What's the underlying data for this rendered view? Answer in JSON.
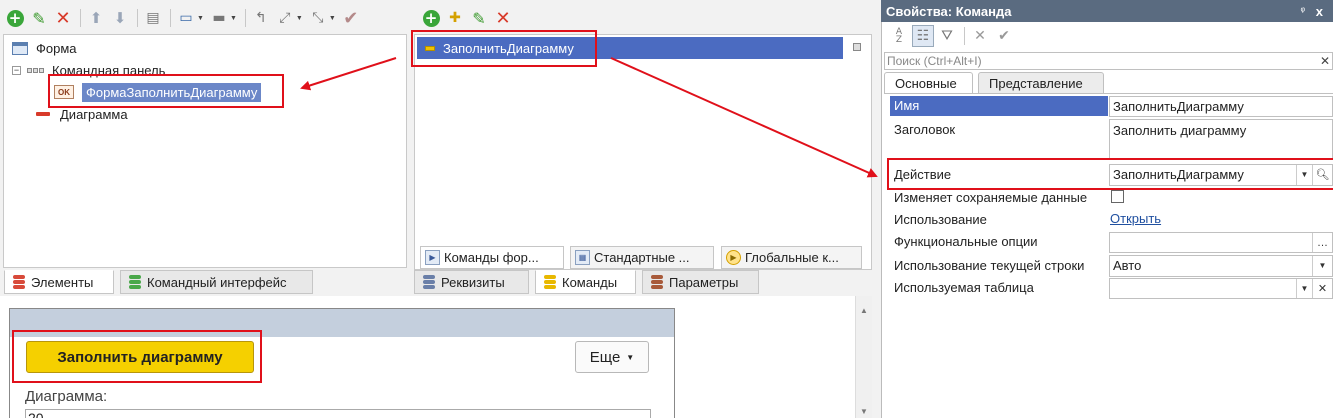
{
  "tree": {
    "items": [
      {
        "label": "Форма"
      },
      {
        "label": "Командная панель"
      },
      {
        "label": "ФормаЗаполнитьДиаграмму"
      },
      {
        "label": "Диаграмма"
      }
    ]
  },
  "left_tabs": [
    "Элементы",
    "Командный интерфейс"
  ],
  "commands": {
    "selected": "ЗаполнитьДиаграмму",
    "inner_tabs": [
      "Команды фор...",
      "Стандартные ...",
      "Глобальные к..."
    ],
    "bottom_tabs": [
      "Реквизиты",
      "Команды",
      "Параметры"
    ]
  },
  "preview": {
    "fill_button": "Заполнить диаграмму",
    "more_button": "Еще",
    "chart_label": "Диаграмма:",
    "chart_value": "20"
  },
  "properties": {
    "title": "Свойства: Команда",
    "pin": "ᵠ",
    "close": "x",
    "search_placeholder": "Поиск (Ctrl+Alt+I)",
    "tabs": [
      "Основные",
      "Представление"
    ],
    "rows": [
      {
        "label": "Имя",
        "value": "ЗаполнитьДиаграмму"
      },
      {
        "label": "Заголовок",
        "value": "Заполнить диаграмму"
      },
      {
        "label": "Действие",
        "value": "ЗаполнитьДиаграмму"
      },
      {
        "label": "Изменяет сохраняемые данные",
        "value": ""
      },
      {
        "label": "Использование",
        "value": "Открыть"
      },
      {
        "label": "Функциональные опции",
        "value": ""
      },
      {
        "label": "Использование текущей строки",
        "value": "Авто"
      },
      {
        "label": "Используемая таблица",
        "value": ""
      }
    ]
  },
  "colors": {
    "highlight": "#e0101a",
    "selection": "#4b6bc1",
    "fill_button": "#f5d000"
  }
}
